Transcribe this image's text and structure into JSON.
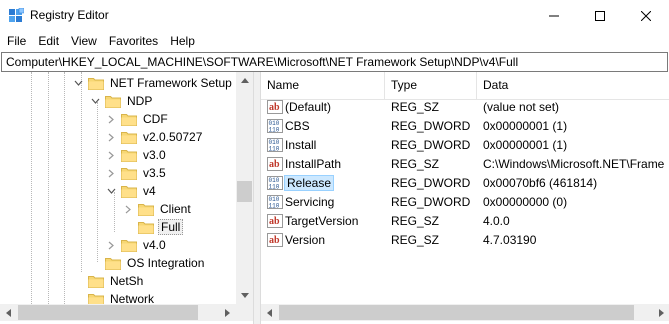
{
  "window": {
    "title": "Registry Editor"
  },
  "menu": [
    "File",
    "Edit",
    "View",
    "Favorites",
    "Help"
  ],
  "address": "Computer\\HKEY_LOCAL_MACHINE\\SOFTWARE\\Microsoft\\NET Framework Setup\\NDP\\v4\\Full",
  "tree": [
    {
      "label": "NET Framework Setup",
      "expander": "expanded"
    },
    {
      "label": "NDP",
      "expander": "expanded"
    },
    {
      "label": "CDF",
      "expander": "collapsed"
    },
    {
      "label": "v2.0.50727",
      "expander": "collapsed"
    },
    {
      "label": "v3.0",
      "expander": "collapsed"
    },
    {
      "label": "v3.5",
      "expander": "collapsed"
    },
    {
      "label": "v4",
      "expander": "expanded"
    },
    {
      "label": "Client",
      "expander": "collapsed"
    },
    {
      "label": "Full",
      "expander": "none",
      "selected": true
    },
    {
      "label": "v4.0",
      "expander": "collapsed"
    },
    {
      "label": "OS Integration",
      "expander": "none"
    },
    {
      "label": "NetSh",
      "expander": "none"
    },
    {
      "label": "Network",
      "expander": "none"
    }
  ],
  "columns": {
    "name": "Name",
    "type": "Type",
    "data": "Data"
  },
  "values": [
    {
      "name": "(Default)",
      "type": "REG_SZ",
      "data": "(value not set)",
      "icon": "string-value-icon"
    },
    {
      "name": "CBS",
      "type": "REG_DWORD",
      "data": "0x00000001 (1)",
      "icon": "binary-value-icon"
    },
    {
      "name": "Install",
      "type": "REG_DWORD",
      "data": "0x00000001 (1)",
      "icon": "binary-value-icon"
    },
    {
      "name": "InstallPath",
      "type": "REG_SZ",
      "data": "C:\\Windows\\Microsoft.NET\\Frame",
      "icon": "string-value-icon"
    },
    {
      "name": "Release",
      "type": "REG_DWORD",
      "data": "0x00070bf6 (461814)",
      "icon": "binary-value-icon",
      "selected": true
    },
    {
      "name": "Servicing",
      "type": "REG_DWORD",
      "data": "0x00000000 (0)",
      "icon": "binary-value-icon"
    },
    {
      "name": "TargetVersion",
      "type": "REG_SZ",
      "data": "4.0.0",
      "icon": "string-value-icon"
    },
    {
      "name": "Version",
      "type": "REG_SZ",
      "data": "4.7.03190",
      "icon": "string-value-icon"
    }
  ],
  "colors": {
    "selection": "#cce8ff",
    "selection_border": "#99d1ff",
    "folder": "#f7d774",
    "string_icon": "#c0392b",
    "binary_icon": "#1f4e8c"
  }
}
